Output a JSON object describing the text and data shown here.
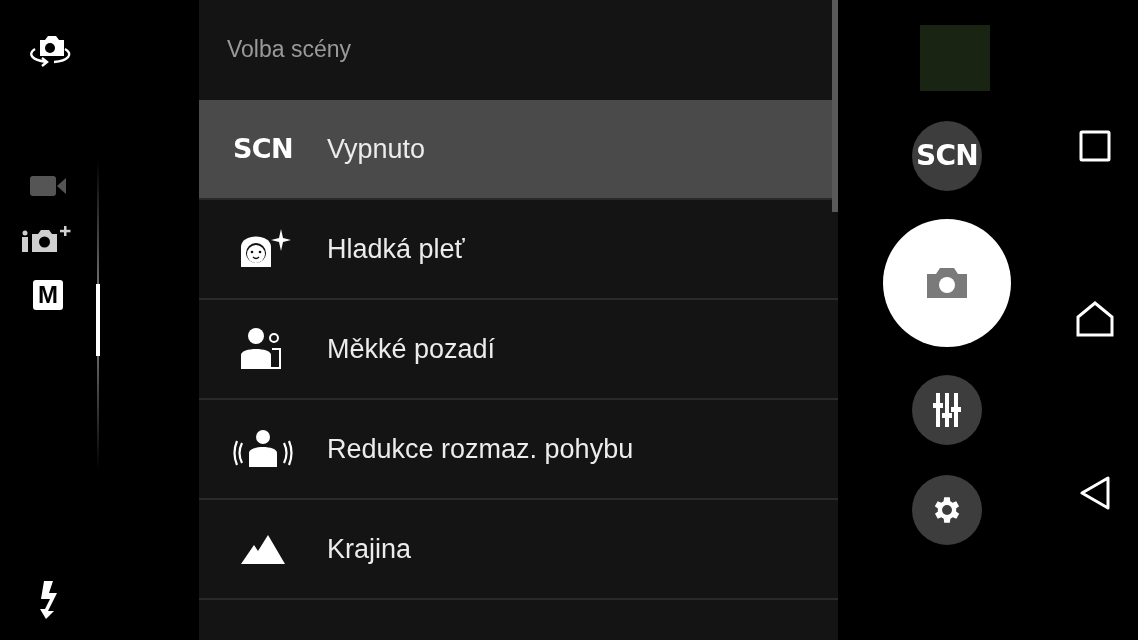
{
  "modes": [
    {
      "kind": "video",
      "selected": false
    },
    {
      "kind": "superior-auto",
      "selected": false
    },
    {
      "kind": "manual",
      "label": "M",
      "selected": true
    }
  ],
  "scene_menu": {
    "title": "Volba scény",
    "items": [
      {
        "kind": "off",
        "icon_text": "SCN",
        "label": "Vypnuto",
        "selected": true
      },
      {
        "kind": "soft-skin",
        "label": "Hladká pleť",
        "selected": false
      },
      {
        "kind": "soft-snap",
        "label": "Měkké pozadí",
        "selected": false
      },
      {
        "kind": "anti-blur",
        "label": "Redukce rozmaz. pohybu",
        "selected": false
      },
      {
        "kind": "landscape",
        "label": "Krajina",
        "selected": false
      }
    ]
  },
  "scene_button": {
    "label": "SCN"
  }
}
